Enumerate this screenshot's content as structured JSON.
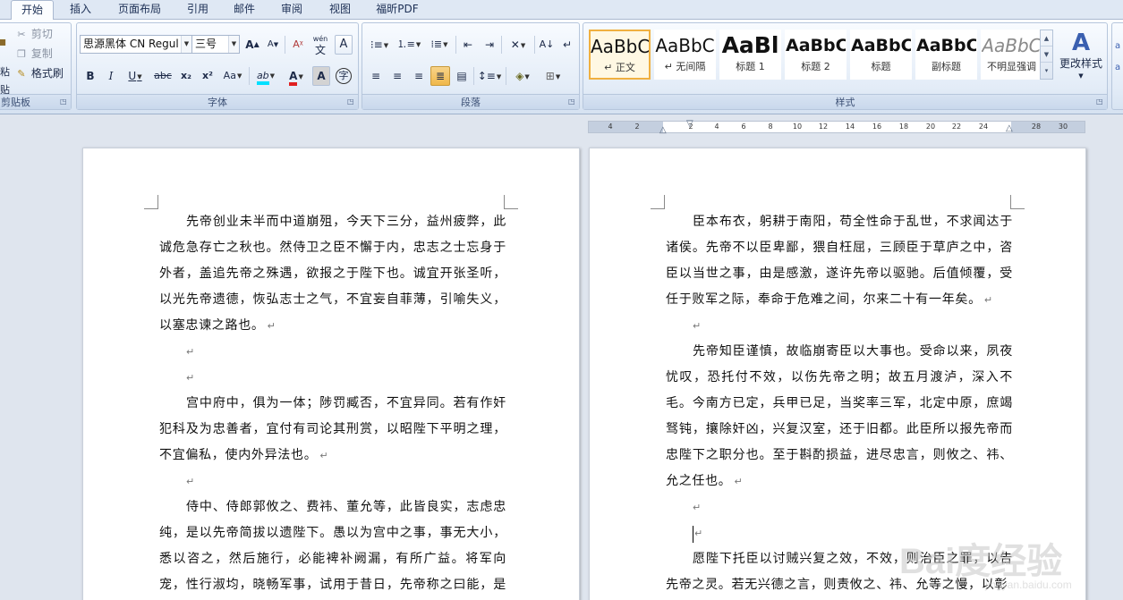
{
  "tabs": [
    "开始",
    "插入",
    "页面布局",
    "引用",
    "邮件",
    "审阅",
    "视图",
    "福昕PDF"
  ],
  "active_tab": "开始",
  "clipboard": {
    "label": "剪贴板",
    "paste": "粘贴",
    "cut": "剪切",
    "copy": "复制",
    "format_painter": "格式刷"
  },
  "font": {
    "label": "字体",
    "name": "思源黑体 CN Regul",
    "size": "三号",
    "grow": "A",
    "shrink": "A",
    "phonetic": "wén",
    "phonetic_char": "文",
    "bold": "B",
    "italic": "I",
    "underline": "U",
    "strike": "abc",
    "subscript": "x₂",
    "superscript": "x²",
    "case": "Aa",
    "highlight": "ab",
    "color": "A",
    "shade": "A",
    "enclose": "字"
  },
  "paragraph": {
    "label": "段落"
  },
  "styles": {
    "label": "样式",
    "items": [
      {
        "sample": "AaBbC",
        "name": "↵ 正文",
        "selected": true
      },
      {
        "sample": "AaBbC",
        "name": "↵ 无间隔",
        "selected": false
      },
      {
        "sample": "AaBl",
        "name": "标题 1",
        "selected": false
      },
      {
        "sample": "AaBbC",
        "name": "标题 2",
        "selected": false
      },
      {
        "sample": "AaBbC",
        "name": "标题",
        "selected": false
      },
      {
        "sample": "AaBbC",
        "name": "副标题",
        "selected": false
      },
      {
        "sample": "AaBbC",
        "name": "不明显强调",
        "selected": false
      }
    ],
    "change_styles": "更改样式"
  },
  "ruler": [
    "4",
    "2",
    "2",
    "4",
    "6",
    "8",
    "10",
    "12",
    "14",
    "16",
    "18",
    "20",
    "22",
    "24",
    "28",
    "30"
  ],
  "page1": {
    "p1": "先帝创业未半而中道崩殂，今天下三分，益州疲弊，此诚危急存亡之秋也。然侍卫之臣不懈于内，忠志之士忘身于外者，盖追先帝之殊遇，欲报之于陛下也。诚宜开张圣听，以光先帝遗德，恢弘志士之气，不宜妄自菲薄，引喻失义，以塞忠谏之路也。",
    "p2": "宫中府中，俱为一体；陟罚臧否，不宜异同。若有作奸犯科及为忠善者，宜付有司论其刑赏，以昭陛下平明之理，不宜偏私，使内外异法也。",
    "p3": "侍中、侍郎郭攸之、费祎、董允等，此皆良实，志虑忠纯，是以先帝简拔以遗陛下。愚以为宫中之事，事无大小，悉以咨之，然后施行，必能裨补阙漏，有所广益。将军向宠，性行淑均，晓畅军事，试用于昔日，先帝称之曰能，是以众"
  },
  "page2": {
    "p1": "臣本布衣，躬耕于南阳，苟全性命于乱世，不求闻达于诸侯。先帝不以臣卑鄙，猥自枉屈，三顾臣于草庐之中，咨臣以当世之事，由是感激，遂许先帝以驱驰。后值倾覆，受任于败军之际，奉命于危难之间，尔来二十有一年矣。",
    "p2": "先帝知臣谨慎，故临崩寄臣以大事也。受命以来，夙夜忧叹，恐托付不效，以伤先帝之明；故五月渡泸，深入不毛。今南方已定，兵甲已足，当奖率三军，北定中原，庶竭驽钝，攘除奸凶，兴复汉室，还于旧都。此臣所以报先帝而忠陛下之职分也。至于斟酌损益，进尽忠言，则攸之、祎、允之任也。",
    "p3": "愿陛下托臣以讨贼兴复之效，不效，则治臣之罪，以告先帝之灵。若无兴德之言，则责攸之、祎、允等之慢，以彰"
  },
  "para_mark": "↵",
  "watermark": {
    "logo": "Bai度经验",
    "url": "jingyan.baidu.com"
  }
}
